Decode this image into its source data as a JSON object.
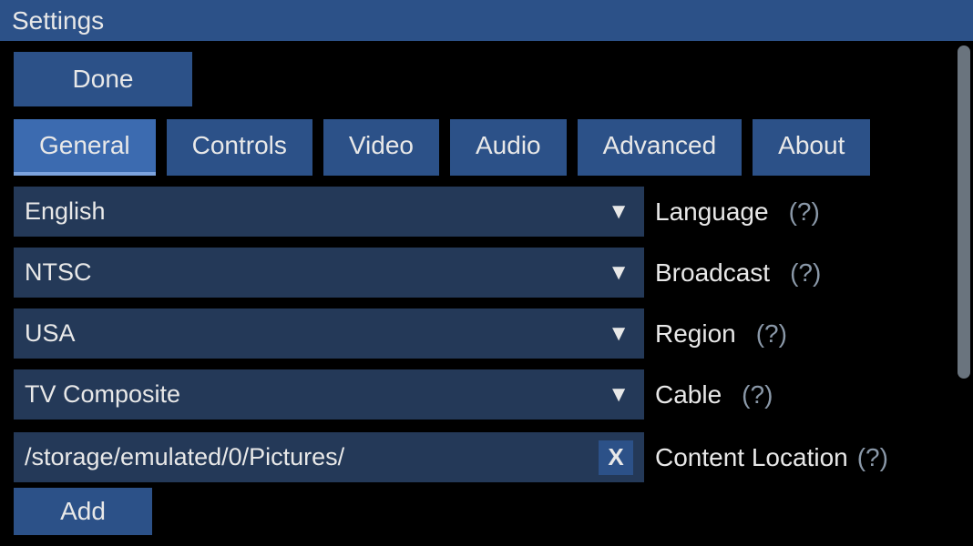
{
  "titlebar": "Settings",
  "done_label": "Done",
  "tabs": {
    "general": "General",
    "controls": "Controls",
    "video": "Video",
    "audio": "Audio",
    "advanced": "Advanced",
    "about": "About"
  },
  "settings": {
    "language": {
      "value": "English",
      "label": "Language",
      "help": "(?)"
    },
    "broadcast": {
      "value": "NTSC",
      "label": "Broadcast",
      "help": "(?)"
    },
    "region": {
      "value": "USA",
      "label": "Region",
      "help": "(?)"
    },
    "cable": {
      "value": "TV Composite",
      "label": "Cable",
      "help": "(?)"
    },
    "content_location": {
      "path": "/storage/emulated/0/Pictures/",
      "remove": "X",
      "add": "Add",
      "label": "Content Location",
      "help": "(?)"
    }
  }
}
